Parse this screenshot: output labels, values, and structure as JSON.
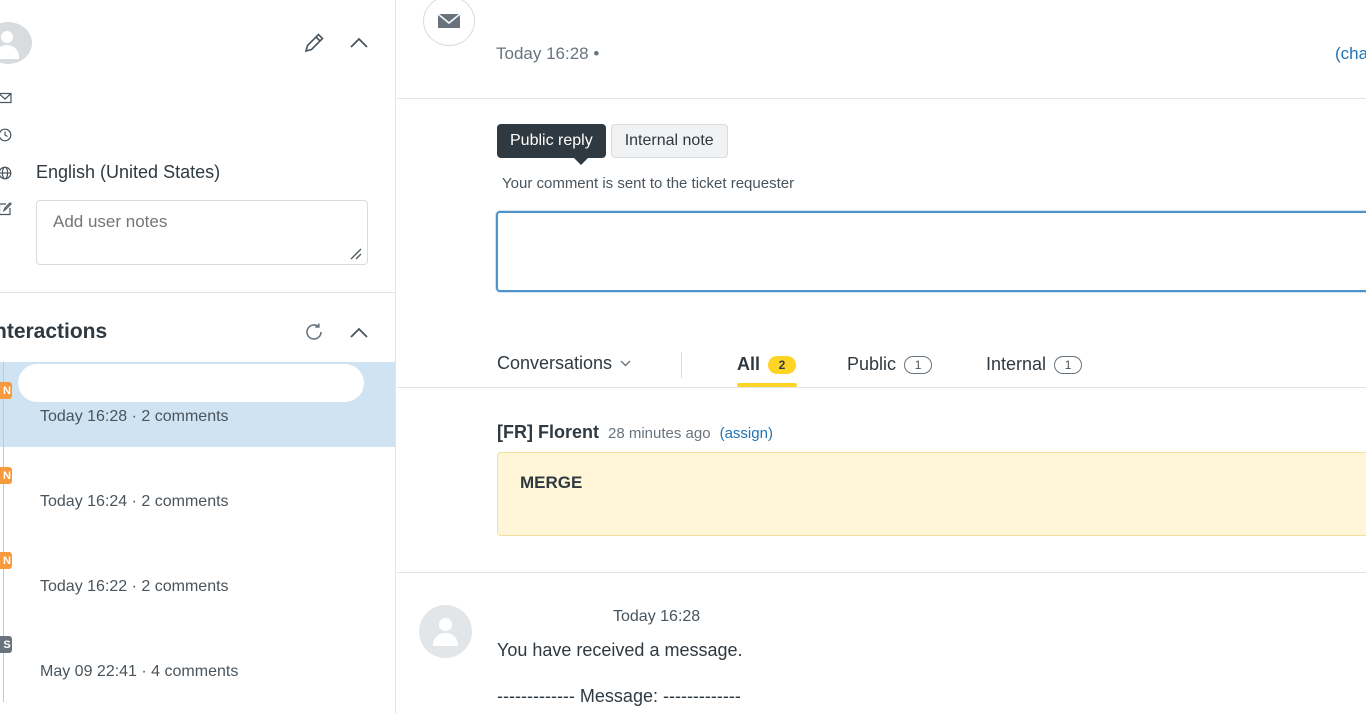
{
  "user_panel": {
    "language": "English (United States)",
    "notes_placeholder": "Add user notes"
  },
  "interactions": {
    "title": "nteractions",
    "items": [
      {
        "badge": "N",
        "status": "new",
        "meta": "Today 16:28 · 2 comments",
        "active": true
      },
      {
        "badge": "N",
        "status": "new",
        "meta": "Today 16:24 · 2 comments",
        "active": false
      },
      {
        "badge": "N",
        "status": "new",
        "meta": "Today 16:22 · 2 comments",
        "active": false
      },
      {
        "badge": "S",
        "status": "solved",
        "meta": "May 09 22:41 · 4 comments",
        "active": false
      }
    ]
  },
  "ticket_header": {
    "timestamp": "Today 16:28 •",
    "change_link": "(cha"
  },
  "composer": {
    "public_reply_label": "Public reply",
    "internal_note_label": "Internal note",
    "hint": "Your comment is sent to the ticket requester"
  },
  "conversation_filter": {
    "dropdown_label": "Conversations",
    "tabs": [
      {
        "label": "All",
        "count": "2",
        "active": true
      },
      {
        "label": "Public",
        "count": "1",
        "active": false
      },
      {
        "label": "Internal",
        "count": "1",
        "active": false
      }
    ]
  },
  "internal_note": {
    "author": "[FR] Florent",
    "time": "28 minutes ago",
    "assign_label": "(assign)",
    "body": "MERGE"
  },
  "message": {
    "time": "Today 16:28",
    "line1": "You have received a message.",
    "line2": "------------- Message: -------------"
  },
  "colors": {
    "accent_blue": "#1f73b7",
    "badge_new": "#f79a3e",
    "badge_solved": "#68737d",
    "count_yellow": "#ffd424",
    "note_background": "#fff6d8",
    "active_row": "#cfe3f3"
  }
}
